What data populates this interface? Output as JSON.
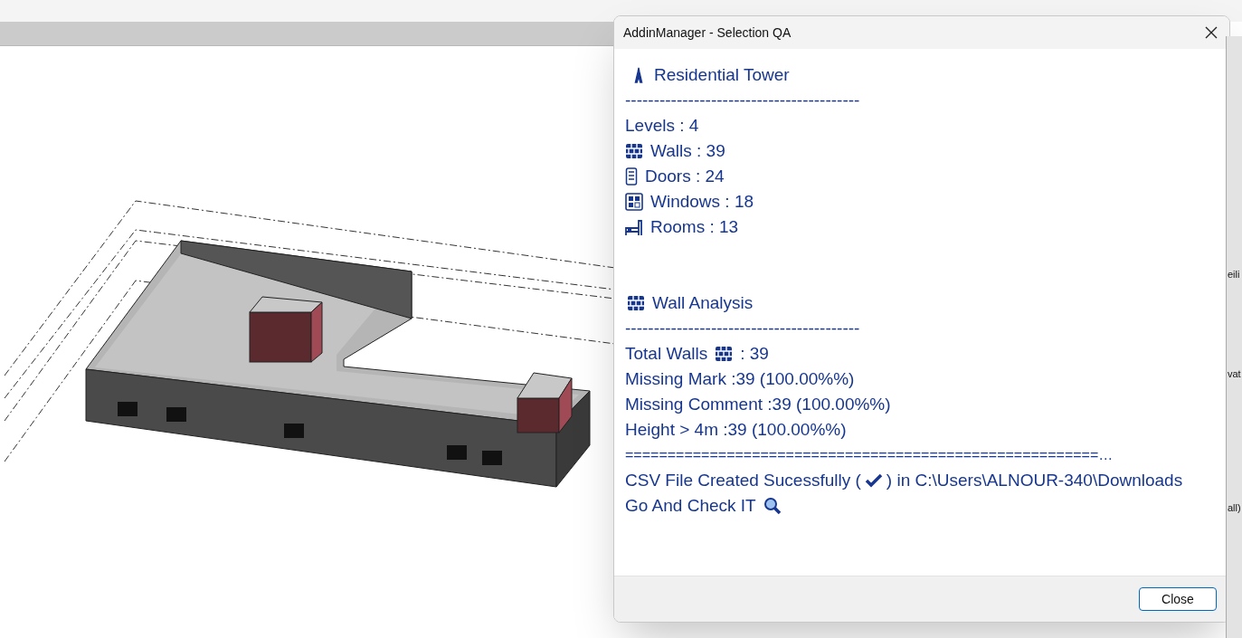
{
  "window": {
    "title": "AddinManager - Selection QA"
  },
  "summary": {
    "title": "Residential Tower",
    "separator": "-----------------------------------------",
    "counts": [
      {
        "kind": "plain",
        "text": "Levels : 4"
      },
      {
        "kind": "wall",
        "text": "Walls : 39"
      },
      {
        "kind": "door",
        "text": "Doors : 24"
      },
      {
        "kind": "window",
        "text": "Windows : 18"
      },
      {
        "kind": "room",
        "text": "Rooms : 13"
      }
    ]
  },
  "analysis": {
    "title": "Wall Analysis",
    "separator": "-----------------------------------------",
    "total": {
      "label": "Total Walls",
      "value": ": 39"
    },
    "lines": [
      "Missing Mark :39 (100.00%%)",
      "Missing Comment :39 (100.00%%)",
      "Height > 4m :39 (100.00%%)"
    ],
    "double_separator": "========================================================…",
    "csv": {
      "before": "CSV File Created Sucessfully (",
      "after": ") in C:\\Users\\ALNOUR-340\\Downloads"
    },
    "check": {
      "text": "Go And Check IT"
    }
  },
  "buttons": [
    {
      "label": "Close"
    }
  ],
  "side_panel": {
    "fragments": [
      "eili",
      "vat",
      "all)"
    ]
  }
}
